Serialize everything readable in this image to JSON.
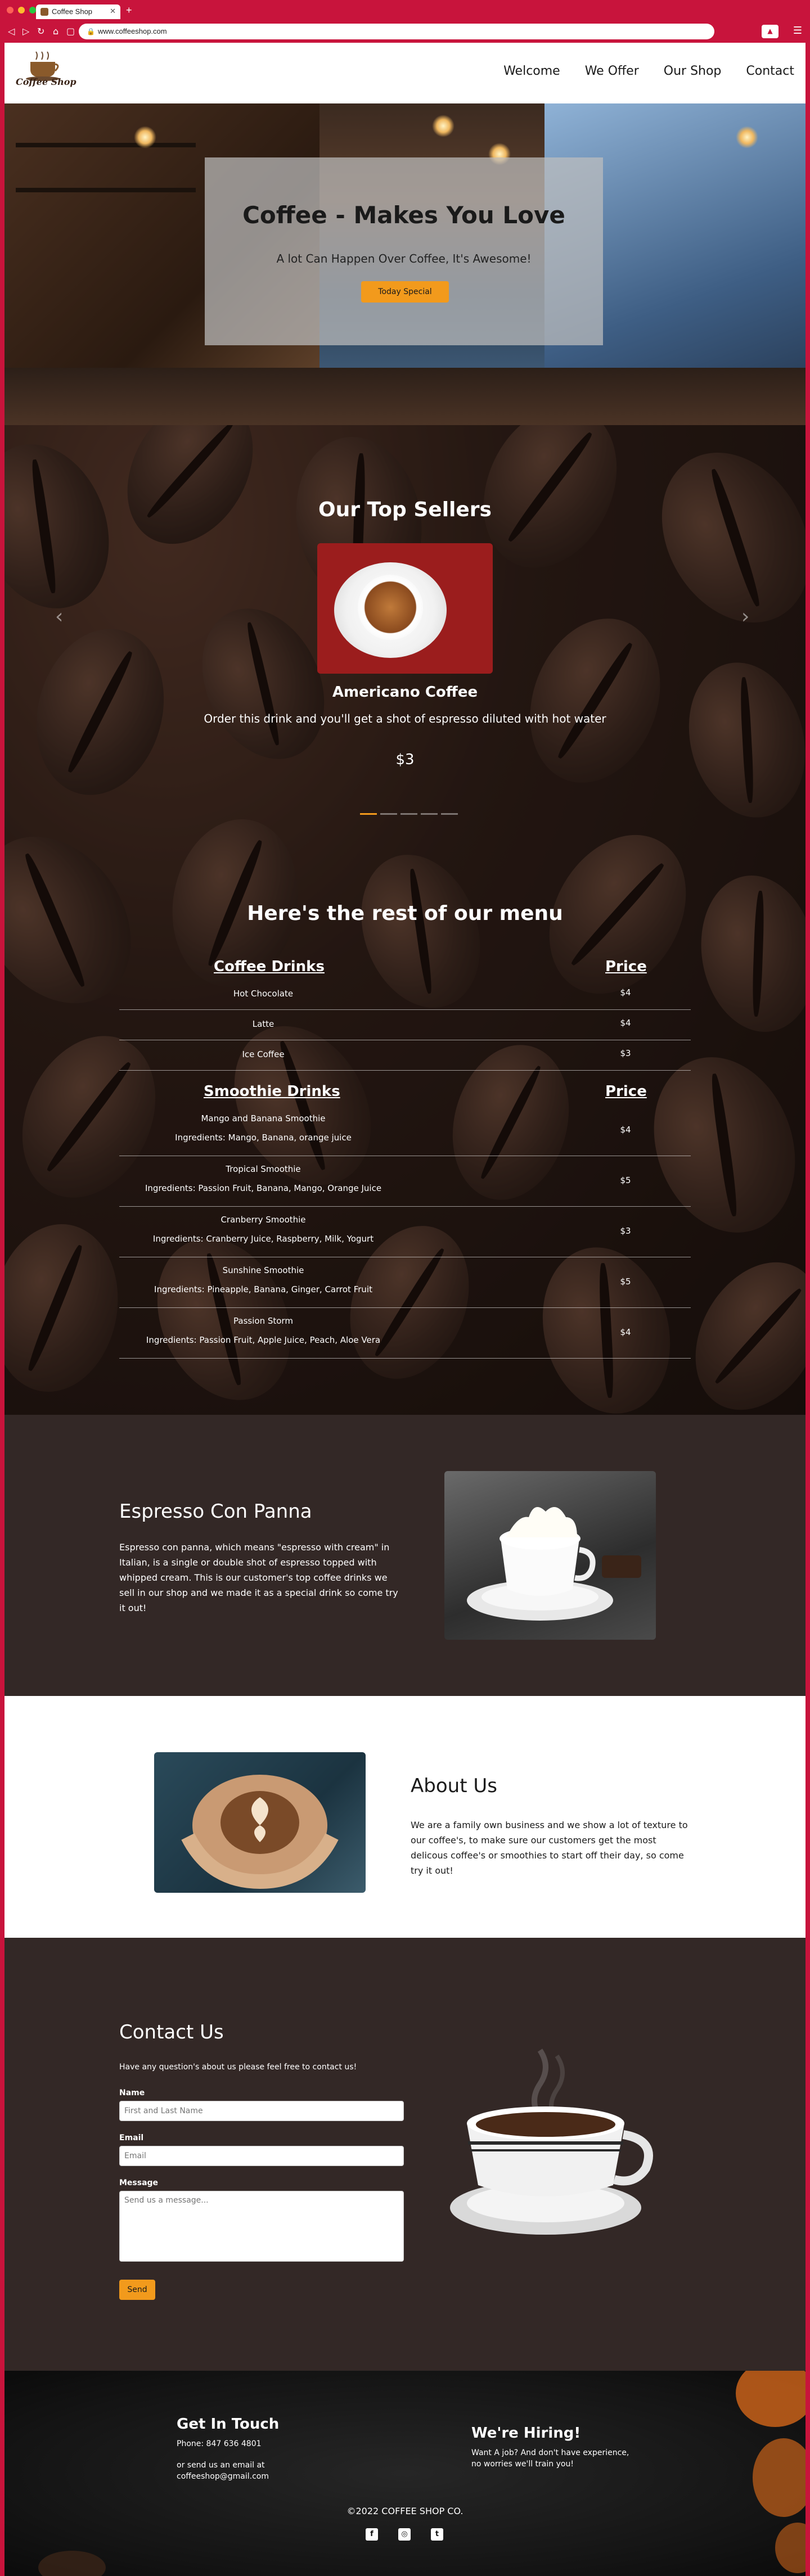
{
  "browser": {
    "tab_title": "Coffee Shop",
    "url": "www.coffeeshop.com"
  },
  "header": {
    "logo_text": "Coffee Shop",
    "nav": [
      "Welcome",
      "We Offer",
      "Our Shop",
      "Contact"
    ]
  },
  "hero": {
    "title": "Coffee - Makes You Love",
    "subtitle": "A lot Can Happen Over Coffee, It's Awesome!",
    "button": "Today Special"
  },
  "top_sellers": {
    "title": "Our Top Sellers",
    "item_name": "Americano Coffee",
    "item_desc": "Order this drink and you'll get a shot of espresso diluted with hot water",
    "item_price": "$3",
    "slide_count": 5,
    "active_slide": 1
  },
  "menu": {
    "title": "Here's the rest of our menu",
    "coffee_header": "Coffee Drinks",
    "price_header": "Price",
    "coffee": [
      {
        "name": "Hot Chocolate",
        "price": "$4"
      },
      {
        "name": "Latte",
        "price": "$4"
      },
      {
        "name": "Ice Coffee",
        "price": "$3"
      }
    ],
    "smoothie_header": "Smoothie Drinks",
    "smoothie_price_header": "Price",
    "smoothies": [
      {
        "name": "Mango and Banana Smoothie",
        "ingredients": "Ingredients: Mango, Banana, orange juice",
        "price": "$4"
      },
      {
        "name": "Tropical Smoothie",
        "ingredients": "Ingredients: Passion Fruit, Banana, Mango, Orange Juice",
        "price": "$5"
      },
      {
        "name": "Cranberry Smoothie",
        "ingredients": "Ingredients: Cranberry Juice, Raspberry, Milk, Yogurt",
        "price": "$3"
      },
      {
        "name": "Sunshine Smoothie",
        "ingredients": "Ingredients: Pineapple, Banana, Ginger, Carrot Fruit",
        "price": "$5"
      },
      {
        "name": "Passion Storm",
        "ingredients": "Ingredients: Passion Fruit, Apple Juice, Peach, Aloe Vera",
        "price": "$4"
      }
    ]
  },
  "panna": {
    "title": "Espresso Con Panna",
    "text": "Espresso con panna, which means \"espresso with cream\" in Italian, is a single or double shot of espresso topped with whipped cream. This is our customer's top coffee drinks we sell in our shop and we made it as a special drink so come try it out!"
  },
  "about": {
    "title": "About Us",
    "text": "We are a family own business and we show a lot of texture to our coffee's, to make sure our customers get the most delicous coffee's or smoothies to start off their day, so come try it out!"
  },
  "contact": {
    "title": "Contact Us",
    "intro": "Have any question's about us please feel free to contact us!",
    "name_label": "Name",
    "name_placeholder": "First and Last Name",
    "email_label": "Email",
    "email_placeholder": "Email",
    "message_label": "Message",
    "message_placeholder": "Send us a message...",
    "send": "Send"
  },
  "footer": {
    "touch_title": "Get In Touch",
    "phone": "Phone: 847 636 4801",
    "email_line1": "or send us an email at",
    "email_line2": "coffeeshop@gmail.com",
    "hiring_title": "We're Hiring!",
    "hiring_text1": "Want A job? And don't have experience,",
    "hiring_text2": "no worries we'll train you!",
    "copyright": "©2022 COFFEE SHOP CO.",
    "socials": [
      "facebook-icon",
      "instagram-icon",
      "twitter-icon"
    ]
  },
  "colors": {
    "accent": "#f29a1c",
    "browser": "#c8143c",
    "dark_section": "#332826"
  }
}
